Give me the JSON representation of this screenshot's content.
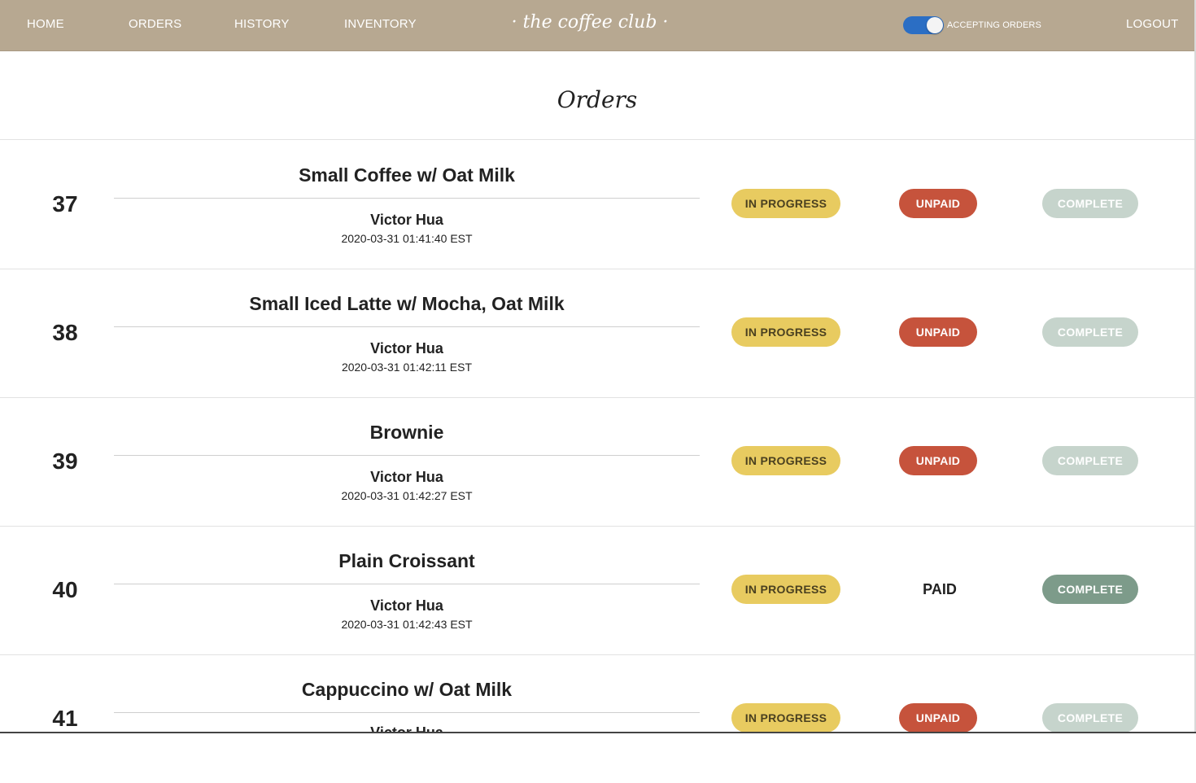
{
  "nav": {
    "home": "HOME",
    "orders": "ORDERS",
    "history": "HISTORY",
    "inventory": "INVENTORY",
    "brand": "· the coffee club ·",
    "toggle_label": "ACCEPTING ORDERS",
    "toggle_on": true,
    "logout": "LOGOUT"
  },
  "page": {
    "title": "Orders"
  },
  "orders": [
    {
      "number": "37",
      "item": "Small Coffee w/ Oat Milk",
      "customer": "Victor Hua",
      "time": "2020-03-31 01:41:40 EST",
      "status": "IN PROGRESS",
      "payment": "UNPAID",
      "complete": "COMPLETE"
    },
    {
      "number": "38",
      "item": "Small Iced Latte w/ Mocha, Oat Milk",
      "customer": "Victor Hua",
      "time": "2020-03-31 01:42:11 EST",
      "status": "IN PROGRESS",
      "payment": "UNPAID",
      "complete": "COMPLETE"
    },
    {
      "number": "39",
      "item": "Brownie",
      "customer": "Victor Hua",
      "time": "2020-03-31 01:42:27 EST",
      "status": "IN PROGRESS",
      "payment": "UNPAID",
      "complete": "COMPLETE"
    },
    {
      "number": "40",
      "item": "Plain Croissant",
      "customer": "Victor Hua",
      "time": "2020-03-31 01:42:43 EST",
      "status": "IN PROGRESS",
      "payment": "PAID",
      "complete": "COMPLETE"
    },
    {
      "number": "41",
      "item": "Cappuccino w/ Oat Milk",
      "customer": "Victor Hua",
      "time": "",
      "status": "IN PROGRESS",
      "payment": "UNPAID",
      "complete": "COMPLETE"
    }
  ],
  "colors": {
    "header": "#b7a891",
    "in_progress": "#e8cb60",
    "unpaid": "#c6533c",
    "complete_disabled": "#c6d4cc",
    "complete_enabled": "#7d9b8a",
    "toggle": "#2b6ec4"
  }
}
